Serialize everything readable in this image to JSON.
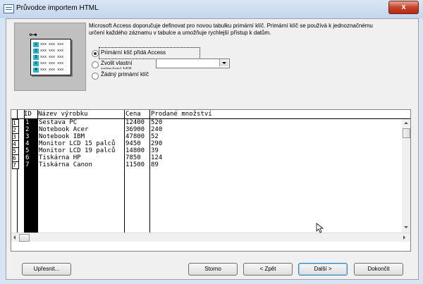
{
  "window": {
    "title": "Průvodce importem HTML",
    "close_label": "x"
  },
  "illustration": {
    "key_icon": "key-icon",
    "rows": [
      {
        "num": "1",
        "text": "xxx xxx xxx"
      },
      {
        "num": "2",
        "text": "xxx xxx xxx"
      },
      {
        "num": "3",
        "text": "xxx xxx xxx"
      },
      {
        "num": "2",
        "text": "xxx xxx xxx"
      },
      {
        "num": "4",
        "text": "xxx xxx xxx"
      }
    ]
  },
  "description": "Microsoft Access doporučuje definovat pro novou tabulku primární klíč. Primární klíč se používá k jednoznačnému určení každého záznamu v tabulce a umožňuje rychlejší přístup k datům.",
  "options": {
    "access_adds": "Primární klíč přidá Access",
    "choose_own_line1": "Zvolit vlastní",
    "choose_own_line2": "primární klíč",
    "no_key": "Žádný primární klíč",
    "selected": "access_adds",
    "combo_value": ""
  },
  "grid": {
    "headers": [
      "ID",
      "Název výrobku",
      "Cena",
      "Prodané množství"
    ],
    "rows": [
      {
        "rownum": "1",
        "id": "1",
        "name": "Sestava PC",
        "price": "12400",
        "qty": "520"
      },
      {
        "rownum": "2",
        "id": "2",
        "name": "Notebook Acer",
        "price": "36900",
        "qty": "240"
      },
      {
        "rownum": "3",
        "id": "3",
        "name": "Notebook IBM",
        "price": "47800",
        "qty": "52"
      },
      {
        "rownum": "4",
        "id": "4",
        "name": "Monitor LCD 15 palců",
        "price": "9450",
        "qty": "290"
      },
      {
        "rownum": "5",
        "id": "5",
        "name": "Monitor LCD 19 palců",
        "price": "14800",
        "qty": "39"
      },
      {
        "rownum": "6",
        "id": "6",
        "name": "Tiskárna HP",
        "price": "7850",
        "qty": "124"
      },
      {
        "rownum": "7",
        "id": "7",
        "name": "Tiskárna Canon",
        "price": "11500",
        "qty": "89"
      }
    ]
  },
  "buttons": {
    "advanced": "Upřesnit...",
    "cancel": "Storno",
    "back": "< Zpět",
    "next": "Další >",
    "finish": "Dokončit"
  },
  "colors": {
    "accent_teal": "#29b6c8",
    "close_red": "#c7432b"
  }
}
